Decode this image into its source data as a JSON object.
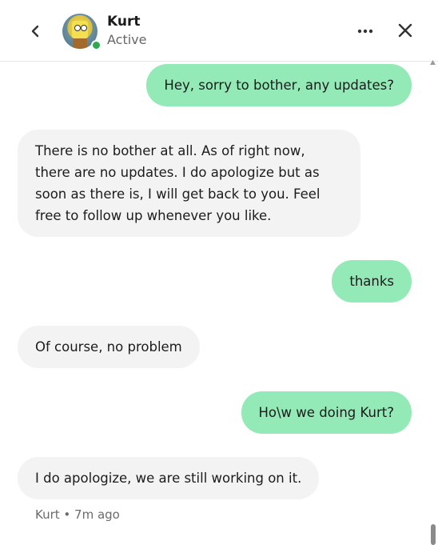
{
  "header": {
    "contact_name": "Kurt",
    "status": "Active",
    "status_color": "#2fa84f",
    "icons": {
      "back": "chevron-left-icon",
      "more": "more-dots-icon",
      "close": "close-icon"
    }
  },
  "messages": [
    {
      "direction": "outgoing",
      "text": "Hey, sorry to bother, any updates?"
    },
    {
      "direction": "incoming",
      "text": "There is no bother at all. As of right now,\nthere are no updates. I do apologize but as\nsoon as there is, I will get back to you. Feel\nfree to follow up whenever you like."
    },
    {
      "direction": "outgoing",
      "text": "thanks"
    },
    {
      "direction": "incoming",
      "text": "Of course, no problem"
    },
    {
      "direction": "outgoing",
      "text": "Ho\\w we doing Kurt?"
    },
    {
      "direction": "incoming",
      "text": "I do apologize, we are still working on it."
    }
  ],
  "last_message_meta": "Kurt • 7m ago",
  "colors": {
    "outgoing_bubble": "#93eab6",
    "incoming_bubble": "#f3f3f3"
  }
}
